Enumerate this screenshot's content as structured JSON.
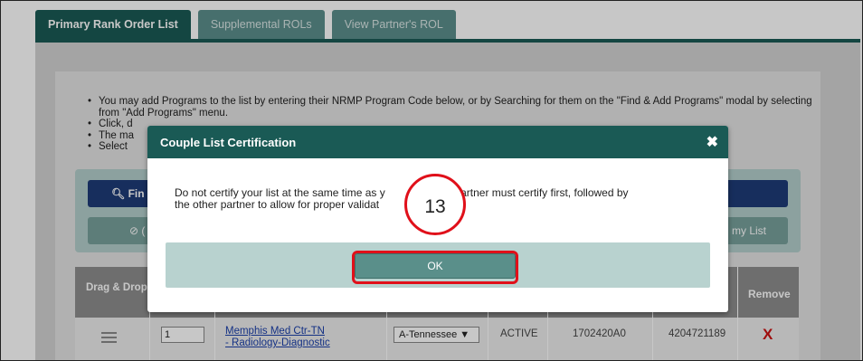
{
  "tabs": [
    {
      "label": "Primary Rank Order List",
      "active": true
    },
    {
      "label": "Supplemental ROLs",
      "active": false
    },
    {
      "label": "View Partner's ROL",
      "active": false
    }
  ],
  "instructions": [
    "You may add Programs to the list by entering their NRMP Program Code below, or by Searching for them on the \"Find & Add Programs\" modal by selecting from \"Add Programs\" menu.",
    "Click, d",
    "The ma",
    "Select"
  ],
  "toolbar": {
    "find_label": "Fin",
    "find_icon": "search-icon",
    "left_partial": "⊘ (",
    "right_partial": "my List"
  },
  "table": {
    "headers": {
      "drag_drop": "Drag & Drop",
      "remove": "Remove"
    },
    "rows": [
      {
        "rank": "1",
        "program_line1": "Memphis Med Ctr-TN",
        "program_line2": "- Radiology-Diagnostic",
        "state": "A-Tennessee ▼",
        "status": "ACTIVE",
        "code": "1702420A0",
        "id": "4204721189",
        "remove": "X"
      }
    ]
  },
  "modal": {
    "title": "Couple List Certification",
    "close_glyph": "✖",
    "body_line1_start": "Do not certify your list at the same time as y",
    "body_line1_end": ". One partner must certify first, followed by",
    "body_line2": "the other partner to allow for proper validat",
    "ok_label": "OK"
  },
  "annotation": {
    "step_number": "13"
  },
  "colors": {
    "tab_active": "#1a5a55",
    "tab_inactive": "#5b8f8c",
    "find_button": "#1e3c78",
    "ok_button": "#5a8f8a",
    "highlight": "#e0101a",
    "remove": "#cc1111"
  }
}
